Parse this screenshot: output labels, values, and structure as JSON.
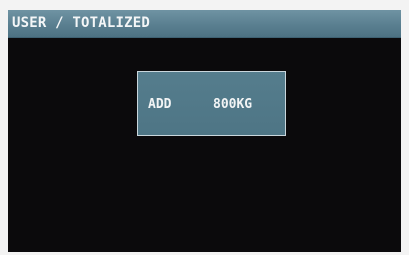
{
  "header": {
    "title": "USER / TOTALIZED"
  },
  "popup": {
    "label": "ADD",
    "value": "800KG"
  },
  "colors": {
    "screen_background": "#0b0a0c",
    "titlebar": "#5a7f90",
    "popup_background": "#527a8a",
    "popup_border": "#c9d6dc",
    "text": "#f2f4f5"
  }
}
